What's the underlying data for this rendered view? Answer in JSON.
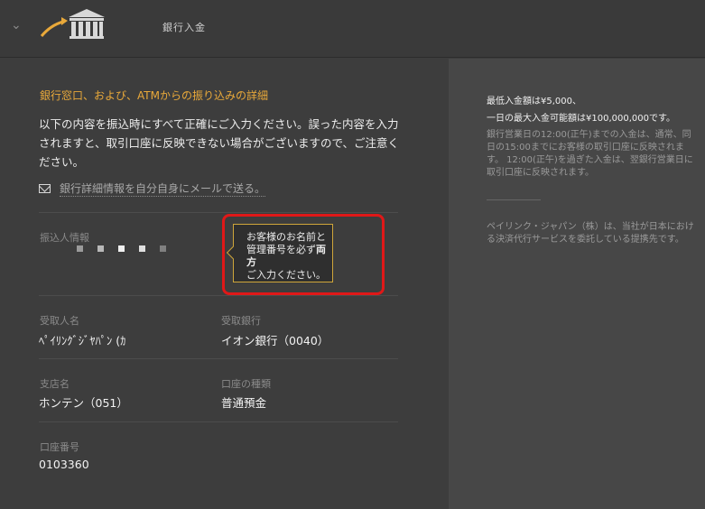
{
  "header": {
    "title": "銀行入金",
    "colors": {
      "logo_arrow": "#e9a93a",
      "logo_bank": "#d8d8d8"
    }
  },
  "main": {
    "section_title": "銀行窓口、および、ATMからの振り込みの詳細",
    "intro": "以下の内容を振込時にすべて正確にご入力ください。誤った内容を入力されますと、取引口座に反映できない場合がございますので、ご注意ください。",
    "email_link": "銀行詳細情報を自分自身にメールで送る。",
    "remitter": {
      "label": "振込人情報"
    },
    "tooltip": {
      "line1": "お客様のお名前と",
      "line2_prefix": "管理番号を必ず",
      "line2_bold": "両方",
      "line3": "ご入力ください。"
    },
    "recipient": {
      "label": "受取人名",
      "value": "ﾍﾟｲﾘﾝｸﾞｼﾞﾔﾊﾟﾝ (ｶ"
    },
    "bank": {
      "label": "受取銀行",
      "value": "イオン銀行（0040）"
    },
    "branch": {
      "label": "支店名",
      "value": "ホンテン（051）"
    },
    "account_type": {
      "label": "口座の種類",
      "value": "普通預金"
    },
    "account_number": {
      "label": "口座番号",
      "value": "0103360"
    },
    "colors": {
      "accent": "#e9a93a",
      "highlight": "#e01818",
      "tooltip_border": "#cfa63a"
    }
  },
  "side": {
    "min_deposit": "最低入金額は¥5,000、",
    "max_deposit": "一日の最大入金可能額は¥100,000,000です。",
    "timing": "銀行営業日の12:00(正午)までの入金は、通常、同日の15:00までにお客様の取引口座に反映されます。 12:00(正午)を過ぎた入金は、翌銀行営業日に取引口座に反映されます。",
    "notice": "ペイリンク・ジャパン（株）は、当社が日本における決済代行サービスを委託している提携先です。"
  }
}
